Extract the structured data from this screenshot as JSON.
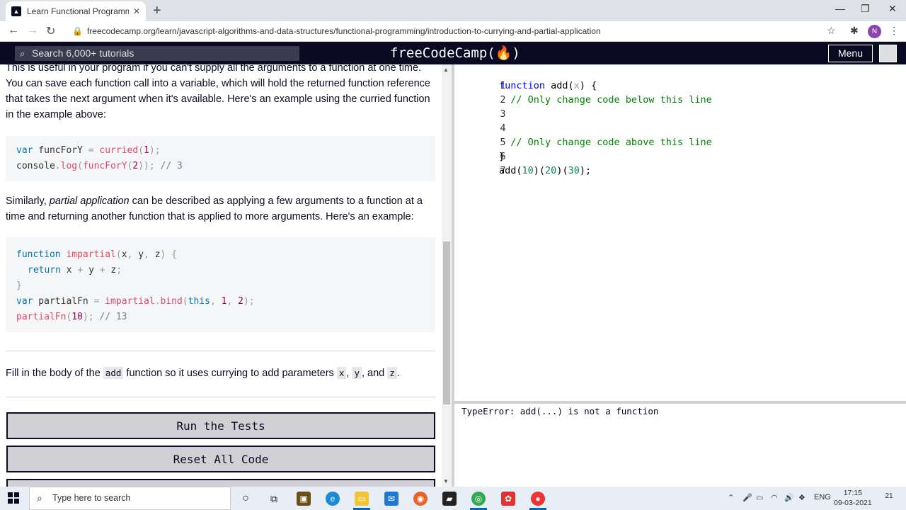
{
  "browser": {
    "tab_title": "Learn Functional Programming: ",
    "tab_close": "✕",
    "new_tab": "+",
    "url": "freecodecamp.org/learn/javascript-algorithms-and-data-structures/functional-programming/introduction-to-currying-and-partial-application",
    "profile_initial": "N",
    "minimize": "—",
    "maximize": "❐",
    "close": "✕"
  },
  "fcc_header": {
    "search_placeholder": "Search 6,000+ tutorials",
    "logo": "freeCodeCamp(🔥)",
    "menu_label": "Menu"
  },
  "lesson": {
    "para1": "This is useful in your program if you can't supply all the arguments to a function at one time. You can save each function call into a variable, which will hold the returned function reference that takes the next argument when it's available. Here's an example using the curried function in the example above:",
    "code1": {
      "l1": {
        "a": "var",
        "b": " funcForY ",
        "c": "=",
        "d": " ",
        "e": "curried",
        "f": "(",
        "g": "1",
        "h": ");"
      },
      "l2": {
        "a": "console",
        "b": ".",
        "c": "log",
        "d": "(",
        "e": "funcForY",
        "f": "(",
        "g": "2",
        "h": ")); ",
        "i": "// 3"
      }
    },
    "para2_pre": "Similarly, ",
    "para2_em": "partial application",
    "para2_post": " can be described as applying a few arguments to a function at a time and returning another function that is applied to more arguments. Here's an example:",
    "code2": {
      "l1": {
        "a": "function",
        "b": " ",
        "c": "impartial",
        "d": "(",
        "e": "x",
        "f": ", ",
        "g": "y",
        "h": ", ",
        "i": "z",
        "j": ") {"
      },
      "l2": {
        "a": "return",
        "b": " x ",
        "c": "+",
        "d": " y ",
        "e": "+",
        "f": " z",
        "g": ";"
      },
      "l3": {
        "a": "}"
      },
      "l4": {
        "a": "var",
        "b": " partialFn ",
        "c": "=",
        "d": " ",
        "e": "impartial",
        "f": ".",
        "g": "bind",
        "h": "(",
        "i": "this",
        "j": ", ",
        "k": "1",
        "l": ", ",
        "m": "2",
        "n": ");"
      },
      "l5": {
        "a": "partialFn",
        "b": "(",
        "c": "10",
        "d": "); ",
        "e": "// 13"
      }
    },
    "instr_pre": "Fill in the body of the ",
    "instr_code1": "add",
    "instr_mid1": " function so it uses currying to add parameters ",
    "instr_x": "x",
    "instr_comma1": ", ",
    "instr_y": "y",
    "instr_and": ", and ",
    "instr_z": "z",
    "instr_end": "."
  },
  "buttons": {
    "run_tests": "Run the Tests",
    "reset_code": "Reset All Code"
  },
  "editor": {
    "lines": [
      {
        "num": "1",
        "kw": "function",
        "rest": " add(",
        "param": "x",
        "rest2": ") {"
      },
      {
        "num": "2",
        "comment": "  // Only change code below this line"
      },
      {
        "num": "3"
      },
      {
        "num": "4"
      },
      {
        "num": "5",
        "comment": "  // Only change code above this line"
      },
      {
        "num": "6",
        "plain": "}"
      },
      {
        "num": "7",
        "p1": "add(",
        "n1": "10",
        "p2": ")(",
        "n2": "20",
        "p3": ")(",
        "n3": "30",
        "p4": ");"
      }
    ]
  },
  "console": {
    "output": "TypeError: add(...) is not a function"
  },
  "taskbar": {
    "search_placeholder": "Type here to search",
    "lang": "ENG",
    "time": "17:15",
    "date": "09-03-2021",
    "notif_count": "21"
  }
}
